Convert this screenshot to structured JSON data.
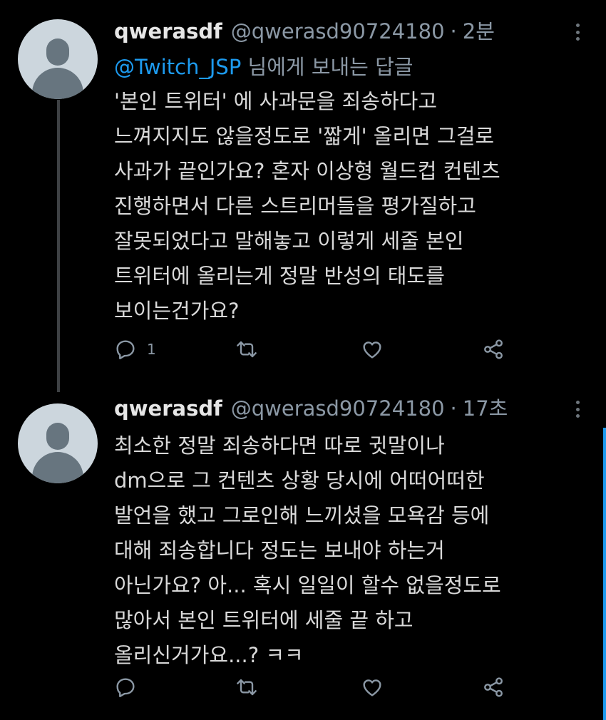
{
  "tweets": [
    {
      "display_name": "qwerasdf",
      "handle": "@qwerasd90724180",
      "separator": "·",
      "time": "2분",
      "reply_to": {
        "mention": "@Twitch_JSP",
        "suffix": " 님에게 보내는 답글"
      },
      "text_lines": [
        "'본인 트위터' 에 사과문을 죄송하다고",
        "느껴지지도 않을정도로 '짧게' 올리면 그걸로",
        "사과가 끝인가요? 혼자 이상형 월드컵 컨텐츠",
        "진행하면서 다른 스트리머들을 평가질하고",
        "잘못되었다고 말해놓고 이렇게 세줄 본인",
        "트위터에 올리는게 정말 반성의 태도를",
        "보이는건가요?"
      ],
      "reply_count": "1"
    },
    {
      "display_name": "qwerasdf",
      "handle": "@qwerasd90724180",
      "separator": "·",
      "time": "17초",
      "text_lines": [
        "최소한 정말 죄송하다면 따로 귓말이나",
        "dm으로 그 컨텐츠 상황 당시에 어떠어떠한",
        "발언을 했고 그로인해 느끼셨을 모욕감 등에",
        "대해 죄송합니다 정도는 보내야 하는거",
        "아닌가요? 아... 혹시 일일이 할수 없을정도로",
        "많아서 본인 트위터에 세줄 끝 하고",
        "올리신거가요...? ㅋㅋ"
      ],
      "reply_count": ""
    }
  ],
  "icons": {
    "avatar": "default-avatar-icon",
    "more": "more-options-icon",
    "reply": "reply-icon",
    "retweet": "retweet-icon",
    "like": "like-icon",
    "share": "share-icon"
  },
  "colors": {
    "background": "#000000",
    "text": "#d9d9d9",
    "muted": "#8b98a5",
    "accent": "#1d9bf0",
    "avatar_bg": "#ccd6dd",
    "avatar_fg": "#67757f"
  }
}
